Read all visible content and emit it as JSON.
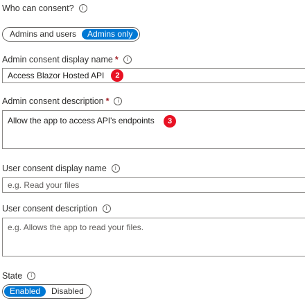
{
  "who_can_consent": {
    "label": "Who can consent?",
    "options": [
      "Admins and users",
      "Admins only"
    ],
    "selected": "Admins only"
  },
  "admin_display_name": {
    "label": "Admin consent display name",
    "required_marker": "*",
    "value": "Access Blazor Hosted API",
    "badge": "2"
  },
  "admin_description": {
    "label": "Admin consent description",
    "required_marker": "*",
    "value": "Allow the app to access API's endpoints",
    "badge": "3"
  },
  "user_display_name": {
    "label": "User consent display name",
    "placeholder": "e.g. Read your files"
  },
  "user_description": {
    "label": "User consent description",
    "placeholder": "e.g. Allows the app to read your files."
  },
  "state": {
    "label": "State",
    "options": [
      "Enabled",
      "Disabled"
    ],
    "selected": "Enabled"
  },
  "info_icon_glyph": "i",
  "colors": {
    "accent": "#0078d4",
    "badge": "#e81123",
    "required": "#a4262c",
    "border": "#8a8886"
  },
  "icons": {
    "info": "info-circle-icon",
    "badge": "callout-number-badge"
  }
}
